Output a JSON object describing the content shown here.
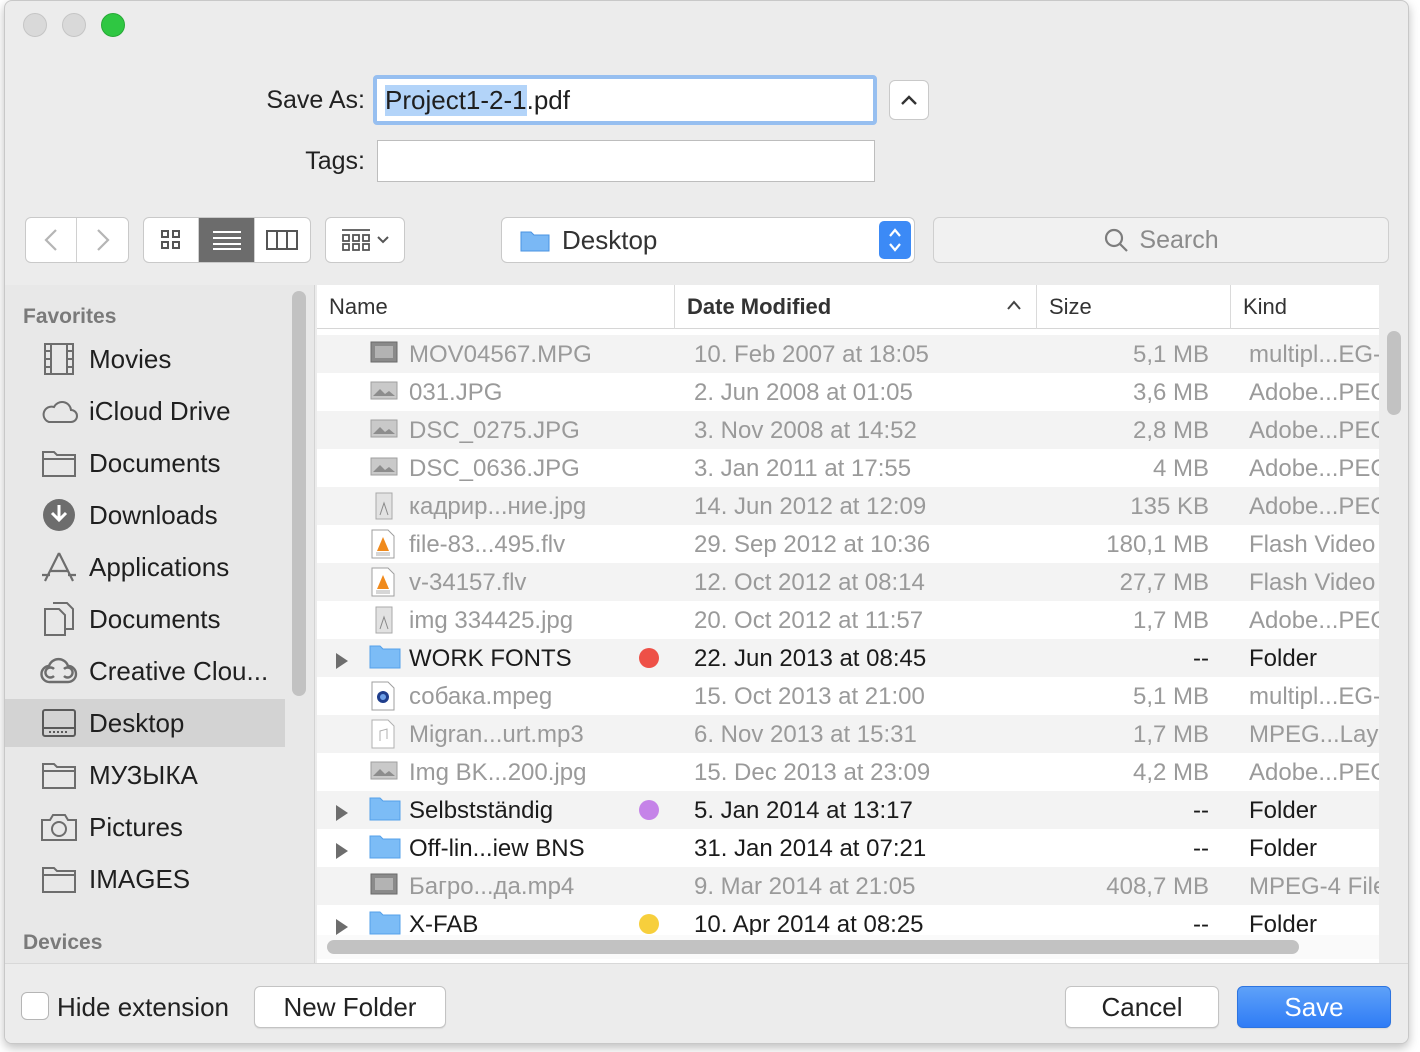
{
  "dialog": {
    "save_as_label": "Save As:",
    "filename_selected": "Project1-2-1",
    "filename_ext": ".pdf",
    "tags_label": "Tags:",
    "tags_value": ""
  },
  "toolbar": {
    "location": "Desktop",
    "search_placeholder": "Search"
  },
  "sidebar": {
    "favorites_title": "Favorites",
    "devices_title": "Devices",
    "items": [
      {
        "label": "Movies",
        "icon": "film-icon"
      },
      {
        "label": "iCloud Drive",
        "icon": "cloud-icon"
      },
      {
        "label": "Documents",
        "icon": "folder-icon"
      },
      {
        "label": "Downloads",
        "icon": "download-icon"
      },
      {
        "label": "Applications",
        "icon": "applications-icon"
      },
      {
        "label": "Documents",
        "icon": "documents-icon"
      },
      {
        "label": "Creative Clou...",
        "icon": "creative-cloud-icon"
      },
      {
        "label": "Desktop",
        "icon": "desktop-icon",
        "selected": true
      },
      {
        "label": "МУЗЫКА",
        "icon": "folder-icon"
      },
      {
        "label": "Pictures",
        "icon": "camera-icon"
      },
      {
        "label": "IMAGES",
        "icon": "folder-icon"
      }
    ]
  },
  "columns": {
    "name": "Name",
    "date": "Date Modified",
    "size": "Size",
    "kind": "Kind"
  },
  "files": [
    {
      "name": "MOV04567.MPG",
      "date": "10. Feb 2007 at 18:05",
      "size": "5,1 MB",
      "kind": "multipl...EG-",
      "type": "video",
      "folder": false
    },
    {
      "name": "031.JPG",
      "date": "2. Jun 2008 at 01:05",
      "size": "3,6 MB",
      "kind": "Adobe...PEG",
      "type": "image",
      "folder": false
    },
    {
      "name": "DSC_0275.JPG",
      "date": "3. Nov 2008 at 14:52",
      "size": "2,8 MB",
      "kind": "Adobe...PEG",
      "type": "image",
      "folder": false
    },
    {
      "name": "DSC_0636.JPG",
      "date": "3. Jan 2011 at 17:55",
      "size": "4 MB",
      "kind": "Adobe...PEG",
      "type": "image",
      "folder": false
    },
    {
      "name": "кадрир...ние.jpg",
      "date": "14. Jun 2012 at 12:09",
      "size": "135 KB",
      "kind": "Adobe...PEG",
      "type": "image-portrait",
      "folder": false
    },
    {
      "name": "file-83...495.flv",
      "date": "29. Sep 2012 at 10:36",
      "size": "180,1 MB",
      "kind": "Flash Video",
      "type": "flv",
      "folder": false
    },
    {
      "name": "v-34157.flv",
      "date": "12. Oct 2012 at 08:14",
      "size": "27,7 MB",
      "kind": "Flash Video",
      "type": "flv",
      "folder": false
    },
    {
      "name": "img 334425.jpg",
      "date": "20. Oct 2012 at 11:57",
      "size": "1,7 MB",
      "kind": "Adobe...PEG",
      "type": "image-portrait",
      "folder": false
    },
    {
      "name": "WORK FONTS",
      "date": "22. Jun 2013 at 08:45",
      "size": "--",
      "kind": "Folder",
      "type": "folder",
      "folder": true,
      "tag": "#ee5047"
    },
    {
      "name": "собака.mpeg",
      "date": "15. Oct 2013 at 21:00",
      "size": "5,1 MB",
      "kind": "multipl...EG-",
      "type": "quicktime",
      "folder": false
    },
    {
      "name": "Migran...urt.mp3",
      "date": "6. Nov 2013 at 15:31",
      "size": "1,7 MB",
      "kind": "MPEG...Laye",
      "type": "audio",
      "folder": false
    },
    {
      "name": "Img BK...200.jpg",
      "date": "15. Dec 2013 at 23:09",
      "size": "4,2 MB",
      "kind": "Adobe...PEG",
      "type": "image",
      "folder": false
    },
    {
      "name": "Selbstständig",
      "date": "5. Jan 2014 at 13:17",
      "size": "--",
      "kind": "Folder",
      "type": "folder",
      "folder": true,
      "tag": "#c583e8"
    },
    {
      "name": "Off-lin...iew BNS",
      "date": "31. Jan 2014 at 07:21",
      "size": "--",
      "kind": "Folder",
      "type": "folder",
      "folder": true
    },
    {
      "name": "Багро...да.mp4",
      "date": "9. Mar 2014 at 21:05",
      "size": "408,7 MB",
      "kind": "MPEG-4 File",
      "type": "video",
      "folder": false
    },
    {
      "name": "X-FAB",
      "date": "10. Apr 2014 at 08:25",
      "size": "--",
      "kind": "Folder",
      "type": "folder",
      "folder": true,
      "tag": "#f7cf3c"
    }
  ],
  "footer": {
    "hide_extension": "Hide extension",
    "new_folder": "New Folder",
    "cancel": "Cancel",
    "save": "Save"
  },
  "colors": {
    "accent": "#3c8af6",
    "selection": "#b3d4f9",
    "focus_ring": "#97bff0"
  }
}
